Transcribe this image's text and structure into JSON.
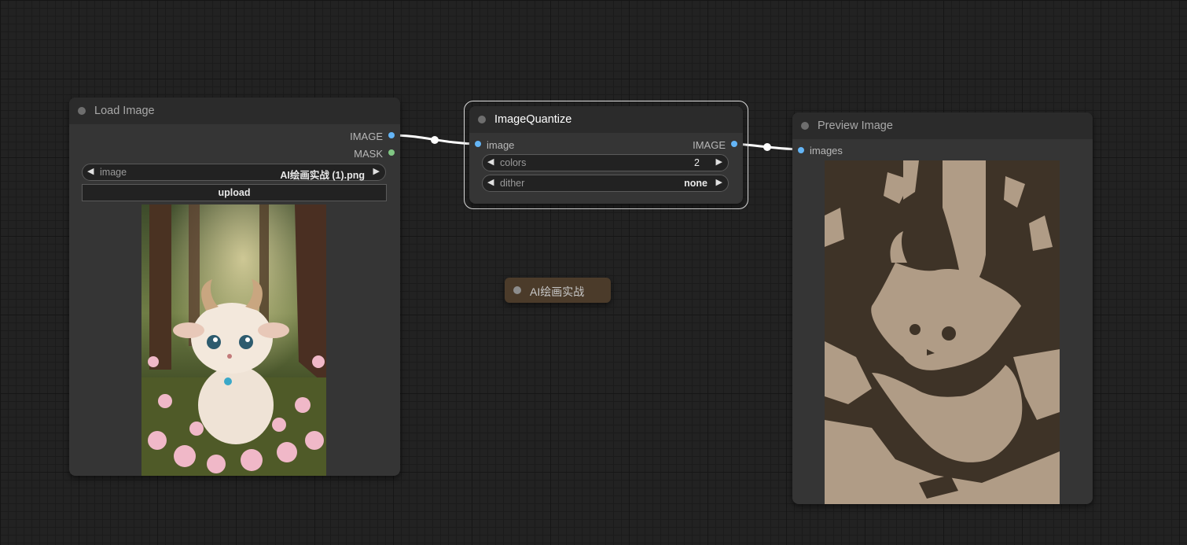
{
  "nodes": {
    "load_image": {
      "title": "Load Image",
      "outputs": [
        "IMAGE",
        "MASK"
      ],
      "image_widget": {
        "label": "image",
        "value": "AI绘画实战 (1).png"
      },
      "upload_label": "upload",
      "preview": "cute fluffy horned creature in a flower forest"
    },
    "image_quantize": {
      "title": "ImageQuantize",
      "input": "image",
      "output": "IMAGE",
      "colors": {
        "label": "colors",
        "value": "2"
      },
      "dither": {
        "label": "dither",
        "value": "none"
      }
    },
    "group_label": {
      "title": "AI绘画实战"
    },
    "preview_image": {
      "title": "Preview Image",
      "input": "images"
    }
  },
  "colors": {
    "canvas_bg": "#222222",
    "node_bg": "#353535",
    "title_bg": "#2b2b2b",
    "image_slot": "#64b5f6",
    "mask_slot": "#81c784",
    "wire": "#ffffff",
    "quantize_dark": "#3e3327",
    "quantize_light": "#b09c86",
    "group_bg": "#4b3b2a"
  },
  "icons": {
    "widget_left": "triangle-left-icon",
    "widget_right": "triangle-right-icon",
    "node_status": "circle-dot-icon"
  }
}
